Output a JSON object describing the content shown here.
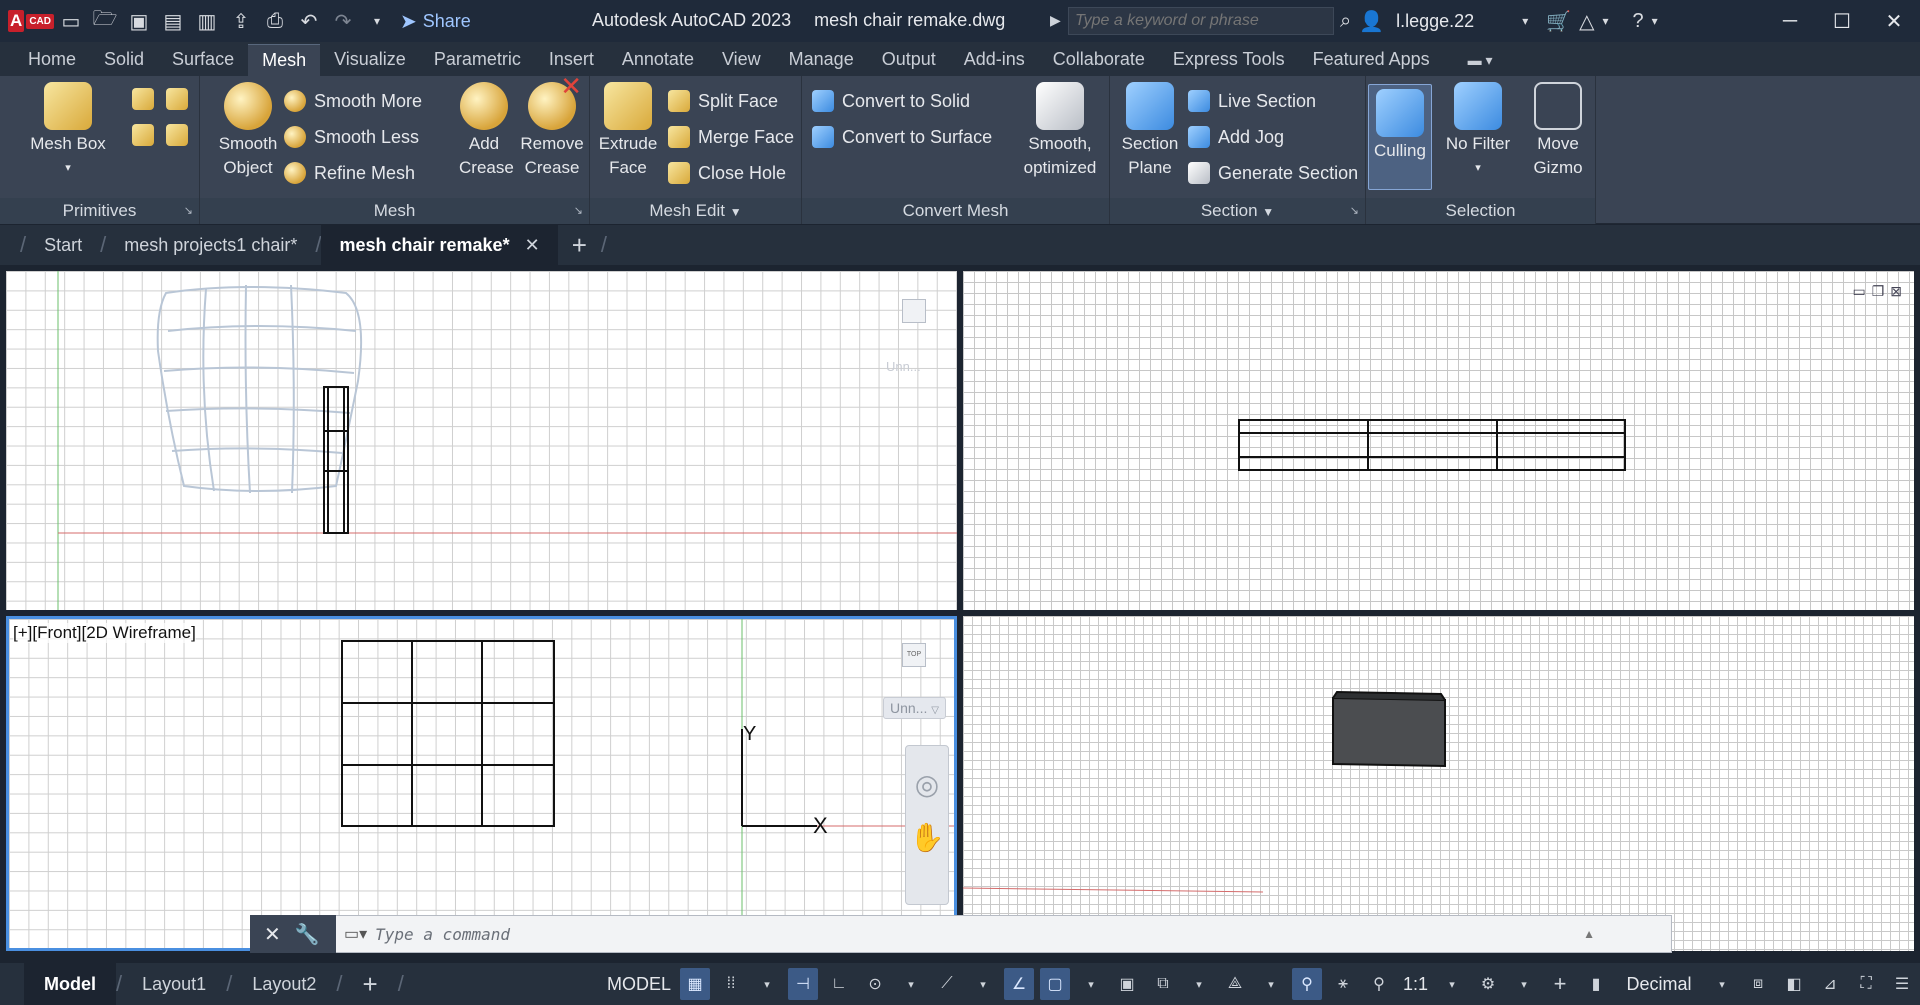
{
  "app": {
    "title": "Autodesk AutoCAD 2023",
    "file": "mesh chair remake.dwg",
    "logo_letter": "A",
    "logo_text": "CAD",
    "share_label": "Share",
    "search_placeholder": "Type a keyword or phrase",
    "username": "l.legge.22",
    "accent_color": "#2f6fc4"
  },
  "quickaccess": {
    "icons": [
      "new-icon",
      "open-icon",
      "save-icon",
      "saveas-icon",
      "publish-icon",
      "open-web-icon",
      "plot-icon",
      "undo-icon",
      "redo-icon",
      "dropdown-icon"
    ]
  },
  "ribbon": {
    "tabs": [
      "Home",
      "Solid",
      "Surface",
      "Mesh",
      "Visualize",
      "Parametric",
      "Insert",
      "Annotate",
      "View",
      "Manage",
      "Output",
      "Add-ins",
      "Collaborate",
      "Express Tools",
      "Featured Apps"
    ],
    "active_tab": "Mesh",
    "panels": {
      "primitives": {
        "title": "Primitives",
        "mesh_box": "Mesh Box"
      },
      "mesh": {
        "title": "Mesh",
        "smooth_object": "Smooth Object",
        "smooth_more": "Smooth More",
        "smooth_less": "Smooth Less",
        "refine_mesh": "Refine Mesh",
        "add_crease": "Add Crease",
        "remove_crease": "Remove Crease"
      },
      "mesh_edit": {
        "title": "Mesh Edit",
        "extrude_face": "Extrude Face",
        "split_face": "Split Face",
        "merge_face": "Merge Face",
        "close_hole": "Close Hole"
      },
      "convert_mesh": {
        "title": "Convert Mesh",
        "convert_to_solid": "Convert to Solid",
        "convert_to_surface": "Convert to Surface",
        "smooth_optimized": "Smooth, optimized"
      },
      "section": {
        "title": "Section",
        "section_plane": "Section Plane",
        "live_section": "Live Section",
        "add_jog": "Add Jog",
        "generate_section": "Generate Section"
      },
      "selection": {
        "title": "Selection",
        "culling": "Culling",
        "no_filter": "No Filter",
        "move_gizmo": "Move Gizmo"
      }
    }
  },
  "doctabs": {
    "start": "Start",
    "tab1": "mesh projects1 chair*",
    "tab2": "mesh chair remake*",
    "close": "✕",
    "add": "+"
  },
  "viewports": {
    "front_label": "[+][Front][2D Wireframe]",
    "wcs_label": "Unn...",
    "viewcube_label": "TOP",
    "ucs_y": "Y",
    "ucs_x": "X"
  },
  "command": {
    "placeholder": "Type a command"
  },
  "statusbar": {
    "layouts": [
      "Model",
      "Layout1",
      "Layout2"
    ],
    "add_layout": "+",
    "model_label": "MODEL",
    "scale": "1:1",
    "units": "Decimal"
  }
}
